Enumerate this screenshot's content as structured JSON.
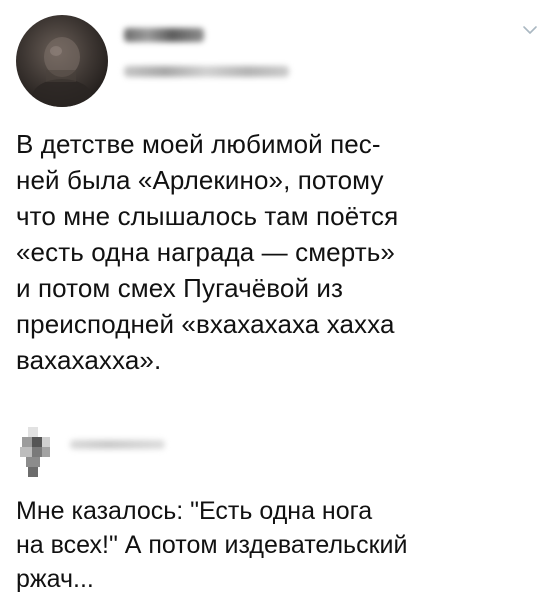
{
  "tweet": {
    "author": {
      "avatar_icon": "user-avatar-icon",
      "display_name_redacted": true,
      "handle_redacted": true
    },
    "menu_icon": "chevron-down-icon",
    "text": "В детстве моей любимой пес-\nней была «Арлекино», потому\nчто мне слышалось там поётся\n«есть одна награда — смерть»\nи потом смех Пугачёвой из\nпреисподней «вхахахаха хахха\nвахахахха»."
  },
  "reply": {
    "author": {
      "avatar_icon": "pixelated-avatar-icon",
      "name_redacted": true
    },
    "text": "Мне казалось: \"Есть одна нога\nна всех!\" А потом издевательский\nржач..."
  },
  "colors": {
    "background": "#ffffff",
    "text": "#111111",
    "chevron": "#aab8c2"
  }
}
